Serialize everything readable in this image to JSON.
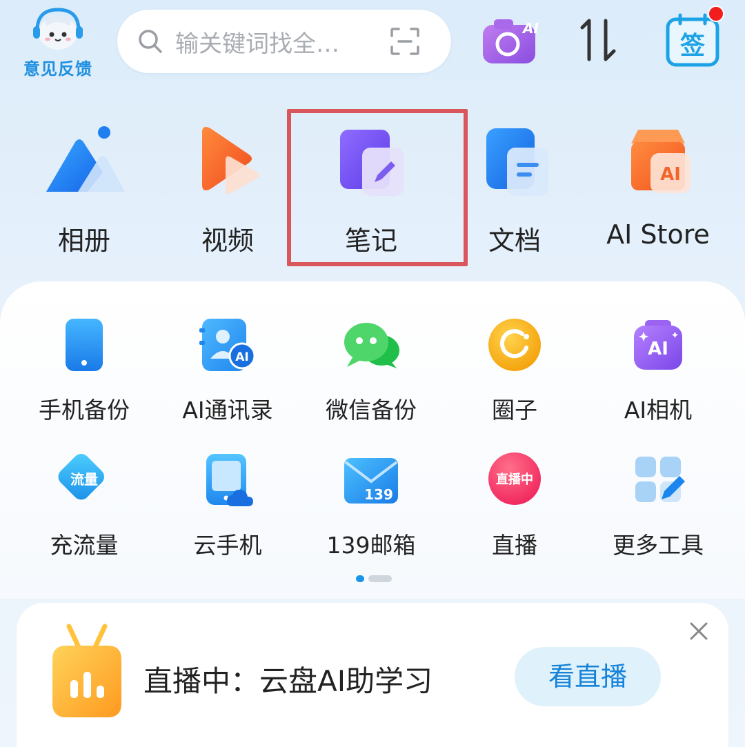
{
  "topbar": {
    "feedback_label": "意见反馈",
    "search_placeholder": "输关键词找全…",
    "sign_label": "签",
    "ai_badge": "AI"
  },
  "main_apps": [
    {
      "label": "相册",
      "icon": "album-icon"
    },
    {
      "label": "视频",
      "icon": "video-play-icon"
    },
    {
      "label": "笔记",
      "icon": "note-icon",
      "highlighted": true
    },
    {
      "label": "文档",
      "icon": "document-icon"
    },
    {
      "label": "AI Store",
      "icon": "ai-store-icon",
      "badge": "AI"
    }
  ],
  "tools": [
    {
      "label": "手机备份",
      "icon": "phone-backup-icon"
    },
    {
      "label": "AI通讯录",
      "icon": "ai-contacts-icon",
      "badge": "AI"
    },
    {
      "label": "微信备份",
      "icon": "wechat-backup-icon"
    },
    {
      "label": "圈子",
      "icon": "circle-icon"
    },
    {
      "label": "AI相机",
      "icon": "ai-camera-icon",
      "badge": "AI"
    },
    {
      "label": "充流量",
      "icon": "data-topup-icon",
      "badge": "流量"
    },
    {
      "label": "云手机",
      "icon": "cloud-phone-icon"
    },
    {
      "label": "139邮箱",
      "icon": "mail-139-icon",
      "badge": "139"
    },
    {
      "label": "直播",
      "icon": "live-icon",
      "badge": "直播中"
    },
    {
      "label": "更多工具",
      "icon": "more-tools-icon"
    }
  ],
  "pager": {
    "pages": 2,
    "current": 1
  },
  "banner": {
    "title": "直播中：云盘AI助学习",
    "button": "看直播"
  },
  "colors": {
    "accent": "#1a94e8",
    "highlight_border": "#d9575c",
    "notification_dot": "#f21d1d"
  }
}
